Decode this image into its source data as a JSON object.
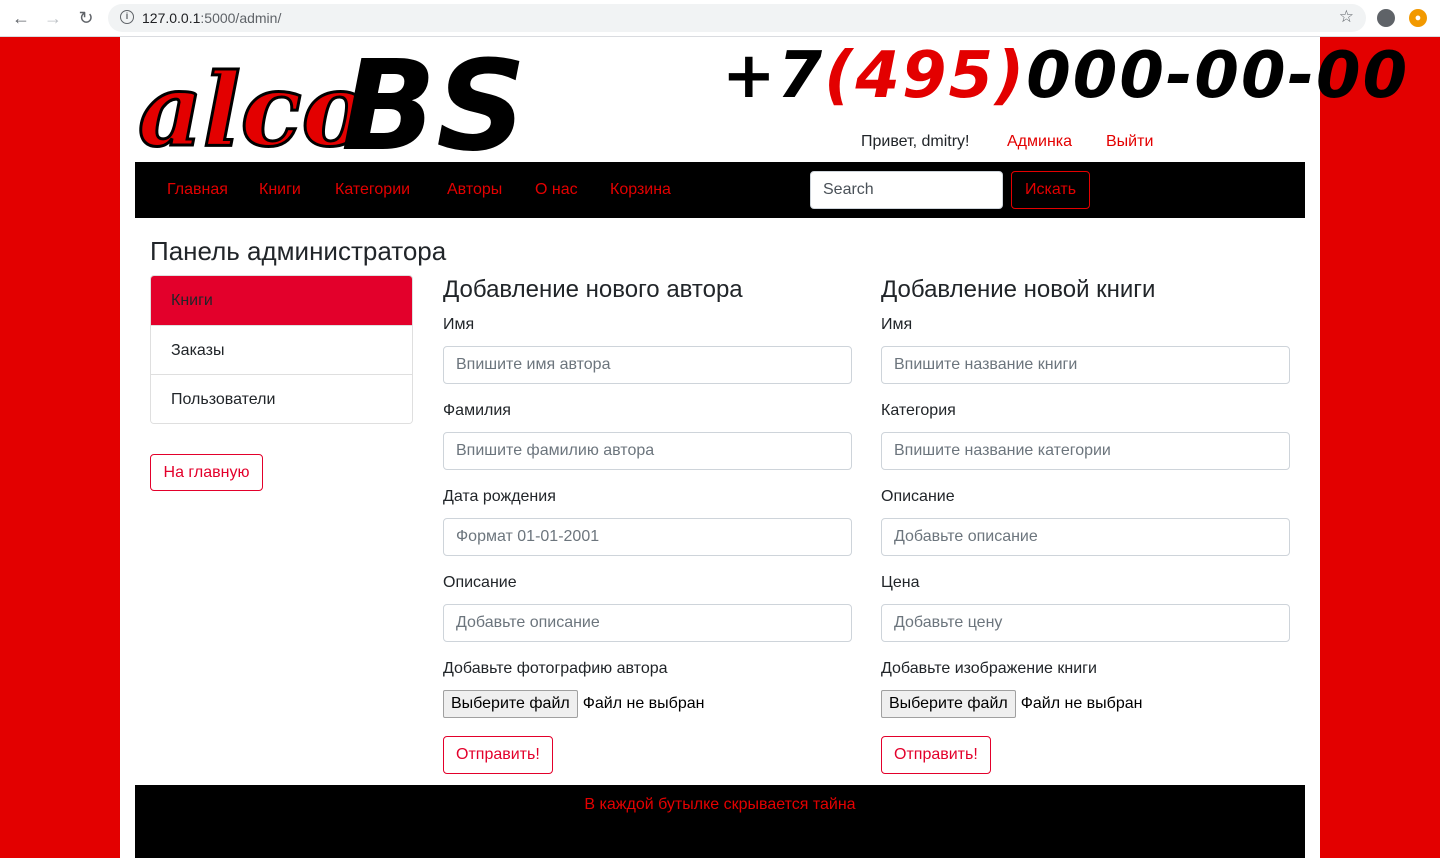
{
  "browser": {
    "url_host": "127.0.0.1",
    "url_rest": ":5000/admin/"
  },
  "header": {
    "logo_part1": "alco",
    "logo_part2": "BS",
    "phone_prefix": "+7",
    "phone_code": "(495)",
    "phone_number": "000-00-00",
    "greeting": "Привет, dmitry!",
    "admin_link": "Админка",
    "logout_link": "Выйти"
  },
  "navbar": {
    "items": [
      "Главная",
      "Книги",
      "Категории",
      "Авторы",
      "О нас",
      "Корзина"
    ],
    "search_placeholder": "Search",
    "search_button": "Искать"
  },
  "main": {
    "title": "Панель администратора",
    "sidebar": {
      "items": [
        {
          "label": "Книги",
          "active": true
        },
        {
          "label": "Заказы",
          "active": false
        },
        {
          "label": "Пользователи",
          "active": false
        }
      ],
      "home_button": "На главную"
    },
    "author_form": {
      "title": "Добавление нового автора",
      "fields": [
        {
          "label": "Имя",
          "placeholder": "Впишите имя автора"
        },
        {
          "label": "Фамилия",
          "placeholder": "Впишите фамилию автора"
        },
        {
          "label": "Дата рождения",
          "placeholder": "Формат 01-01-2001"
        },
        {
          "label": "Описание",
          "placeholder": "Добавьте описание"
        }
      ],
      "file_label": "Добавьте фотографию автора",
      "file_button": "Выберите файл",
      "file_status": "Файл не выбран",
      "submit": "Отправить!"
    },
    "book_form": {
      "title": "Добавление новой книги",
      "fields": [
        {
          "label": "Имя",
          "placeholder": "Впишите название книги"
        },
        {
          "label": "Категория",
          "placeholder": "Впишите название категории"
        },
        {
          "label": "Описание",
          "placeholder": "Добавьте описание"
        },
        {
          "label": "Цена",
          "placeholder": "Добавьте цену"
        }
      ],
      "file_label": "Добавьте изображение книги",
      "file_button": "Выберите файл",
      "file_status": "Файл не выбран",
      "submit": "Отправить!"
    }
  },
  "footer": {
    "text": "В каждой бутылке скрывается тайна"
  },
  "colors": {
    "brand_red": "#e30000",
    "accent_red": "#e3002b",
    "navbar_bg": "#000000"
  }
}
